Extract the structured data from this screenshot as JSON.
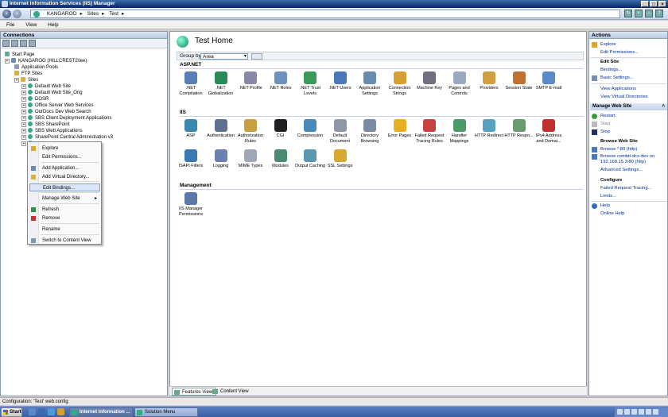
{
  "window": {
    "title": "Internet Information Services (IIS) Manager"
  },
  "address": {
    "crumbs": [
      "KANGAROO",
      "Sites",
      "Test"
    ]
  },
  "menu": [
    "File",
    "View",
    "Help"
  ],
  "connections": {
    "title": "Connections",
    "tree": [
      {
        "label": "Start Page",
        "icon": "start-page-icon"
      },
      {
        "label": "KANGAROO (HILLCREST2\\lee)",
        "icon": "server-icon"
      },
      {
        "label": "Application Pools",
        "icon": "app-pool-icon"
      },
      {
        "label": "FTP Sites",
        "icon": "folder-icon"
      },
      {
        "label": "Sites",
        "icon": "folder-icon"
      },
      {
        "label": "Default Web Site",
        "icon": "globe-icon"
      },
      {
        "label": "Default Web Site_Orig",
        "icon": "globe-icon"
      },
      {
        "label": "DOSR",
        "icon": "globe-icon"
      },
      {
        "label": "Office Server Web Services",
        "icon": "globe-icon"
      },
      {
        "label": "OurDocs Dev Web Search",
        "icon": "globe-icon"
      },
      {
        "label": "SBS Client Deployment Applications",
        "icon": "globe-icon"
      },
      {
        "label": "SBS SharePoint",
        "icon": "globe-icon"
      },
      {
        "label": "SBS Web Applications",
        "icon": "globe-icon"
      },
      {
        "label": "SharePoint Central Administration v3",
        "icon": "globe-icon"
      },
      {
        "label": "Test",
        "icon": "globe-icon"
      }
    ]
  },
  "context_menu": [
    {
      "label": "Explore",
      "icon": "explore-icon"
    },
    {
      "label": "Edit Permissions...",
      "icon": ""
    },
    {
      "label": "Add Application...",
      "icon": "add-app-icon"
    },
    {
      "label": "Add Virtual Directory...",
      "icon": "add-vdir-icon"
    },
    {
      "label": "Edit Bindings...",
      "icon": ""
    },
    {
      "label": "Manage Web Site",
      "icon": "",
      "submenu": "▸"
    },
    {
      "label": "Refresh",
      "icon": "refresh-icon"
    },
    {
      "label": "Remove",
      "icon": "remove-icon"
    },
    {
      "label": "Rename",
      "icon": ""
    },
    {
      "label": "Switch to Content View",
      "icon": "content-view-icon"
    }
  ],
  "main": {
    "title": "Test Home",
    "group_by_label": "Group by:",
    "group_by_value": "Area",
    "sections": [
      {
        "name": "ASP.NET",
        "features": [
          {
            "label": ".NET Compilation",
            "color": "#5a7fb8"
          },
          {
            "label": ".NET Globalization",
            "color": "#2a8a5a"
          },
          {
            "label": ".NET Profile",
            "color": "#8888a8"
          },
          {
            "label": ".NET Roles",
            "color": "#7090c0"
          },
          {
            "label": ".NET Trust Levels",
            "color": "#3a9a5a"
          },
          {
            "label": ".NET Users",
            "color": "#4a78b8"
          },
          {
            "label": "Application Settings",
            "color": "#6a8ab0"
          },
          {
            "label": "Connection Strings",
            "color": "#d8a030"
          },
          {
            "label": "Machine Key",
            "color": "#707080"
          },
          {
            "label": "Pages and Controls",
            "color": "#9aa8c0"
          },
          {
            "label": "Providers",
            "color": "#d0a040"
          },
          {
            "label": "Session State",
            "color": "#c07030"
          },
          {
            "label": "SMTP E-mail",
            "color": "#5a8ac8"
          }
        ]
      },
      {
        "name": "IIS",
        "features": [
          {
            "label": "ASP",
            "color": "#3a88b0"
          },
          {
            "label": "Authentication",
            "color": "#607090"
          },
          {
            "label": "Authorization Rules",
            "color": "#c8a040"
          },
          {
            "label": "CGI",
            "color": "#202020"
          },
          {
            "label": "Compression",
            "color": "#4a8ab8"
          },
          {
            "label": "Default Document",
            "color": "#9098a8"
          },
          {
            "label": "Directory Browsing",
            "color": "#7a8aa0"
          },
          {
            "label": "Error Pages",
            "color": "#e8b020"
          },
          {
            "label": "Failed Request Tracing Rules",
            "color": "#c84040"
          },
          {
            "label": "Handler Mappings",
            "color": "#4a9a6a"
          },
          {
            "label": "HTTP Redirect",
            "color": "#5aa0c0"
          },
          {
            "label": "HTTP Respo...",
            "color": "#6a9a70"
          },
          {
            "label": "IPv4 Address and Domai...",
            "color": "#c03030"
          },
          {
            "label": "ISAPI Filters",
            "color": "#3a7ab0"
          },
          {
            "label": "Logging",
            "color": "#6a80b0"
          },
          {
            "label": "MIME Types",
            "color": "#a0a8b8"
          },
          {
            "label": "Modules",
            "color": "#4a8a70"
          },
          {
            "label": "Output Caching",
            "color": "#5a98b0"
          },
          {
            "label": "SSL Settings",
            "color": "#d8a830"
          }
        ]
      },
      {
        "name": "Management",
        "features": [
          {
            "label": "IIS Manager Permissions",
            "color": "#5a78a8"
          }
        ]
      }
    ]
  },
  "bottom_tabs": {
    "features_view": "Features View",
    "content_view": "Content View"
  },
  "actions": {
    "title": "Actions",
    "explore": "Explore",
    "edit_permissions": "Edit Permissions...",
    "edit_site_hdr": "Edit Site",
    "bindings": "Bindings...",
    "basic_settings": "Basic Settings...",
    "view_applications": "View Applications",
    "view_virtual_dirs": "View Virtual Directories",
    "manage_web_site": "Manage Web Site",
    "restart": "Restart",
    "start": "Start",
    "stop": "Stop",
    "browse_hdr": "Browse Web Site",
    "browse_80": "Browse *:80 (http)",
    "browse_combit_1": "Browse combit-dcs-dev on",
    "browse_combit_2": "192.168.15.3:80 (http)",
    "advanced_settings": "Advanced Settings...",
    "configure_hdr": "Configure",
    "failed_tracing": "Failed Request Tracing...",
    "limits": "Limits...",
    "help": "Help",
    "online_help": "Online Help"
  },
  "status": {
    "text": "Configuration: 'Test' web.config"
  },
  "taskbar": {
    "start": "Start",
    "task1": "Internet Information ...",
    "task2": "Solution Menu"
  }
}
